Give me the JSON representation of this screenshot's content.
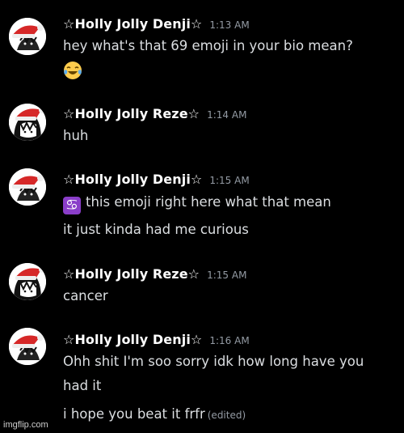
{
  "messages": [
    {
      "username": "☆Holly Jolly Denji☆",
      "timestamp": "1:13 AM",
      "lines": [
        "hey what's that 69 emoji in your bio mean?"
      ],
      "emoji": "face-with-tears-of-joy"
    },
    {
      "username": "☆Holly Jolly Reze☆",
      "timestamp": "1:14 AM",
      "lines": [
        "huh"
      ]
    },
    {
      "username": "☆Holly Jolly Denji☆",
      "timestamp": "1:15 AM",
      "lines": [
        "this emoji right here what that mean",
        "it just kinda had me curious"
      ],
      "emoji": "cancer-zodiac",
      "emoji_glyph": "♋"
    },
    {
      "username": "☆Holly Jolly Reze☆",
      "timestamp": "1:15 AM",
      "lines": [
        "cancer"
      ]
    },
    {
      "username": "☆Holly Jolly Denji☆",
      "timestamp": "1:16 AM",
      "lines": [
        "Ohh shit I'm soo sorry idk how long have you",
        "had it",
        "i hope you beat it frfr"
      ],
      "edited_label": "(edited)"
    }
  ],
  "watermark": "imgflip.com",
  "colors": {
    "background": "#000000",
    "username": "#ffffff",
    "message_text": "#dbdee1",
    "timestamp": "#949ba4",
    "santa_hat_red": "#d62828",
    "cancer_emoji_bg": "#8a3ec9"
  }
}
